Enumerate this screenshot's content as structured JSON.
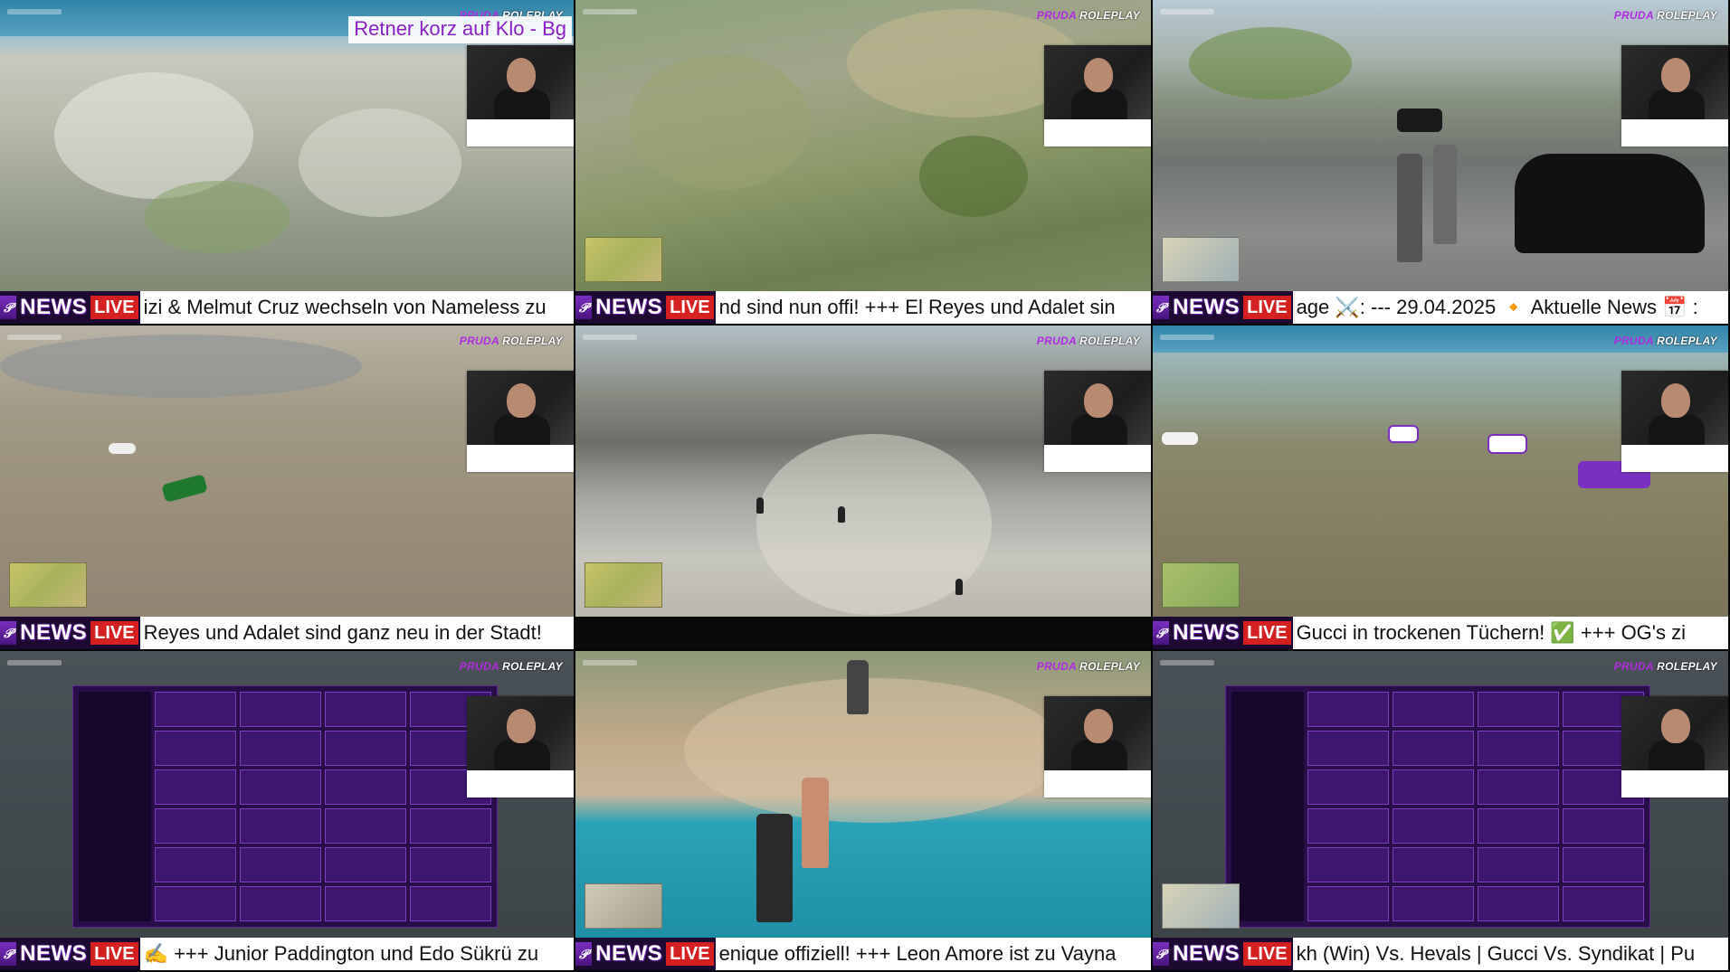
{
  "brand": {
    "part1": "PRUDA",
    "part2": "ROLEPLAY"
  },
  "ticker": {
    "logo_icon": "pruda-logo-icon",
    "news": "NEWS",
    "live": "LIVE"
  },
  "colors": {
    "accent_purple": "#8a1fc7",
    "live_red": "#d42020",
    "ticker_bg": "#ffffff"
  },
  "tiles": [
    {
      "caption": "Retner korz auf Klo - Bg",
      "ticker_text": "izi & Melmut Cruz wechseln von Nameless zu"
    },
    {
      "ticker_text": "nd sind nun offi! +++ El Reyes und Adalet sin"
    },
    {
      "ticker_text": "age ⚔️: --- 29.04.2025 🔸 Aktuelle News 📅 :"
    },
    {
      "ticker_text": "Reyes und Adalet sind ganz neu in der Stadt!"
    },
    {
      "ticker_text": ""
    },
    {
      "ticker_text": " Gucci in trockenen Tüchern! ✅ +++ OG's zi"
    },
    {
      "ticker_text": "✍️ +++ Junior Paddington und Edo Sükrü zu"
    },
    {
      "ticker_text": "enique offiziell! +++ Leon Amore ist zu Vayna"
    },
    {
      "ticker_text": "kh (Win) Vs. Hevals | Gucci Vs. Syndikat | Pu"
    }
  ]
}
